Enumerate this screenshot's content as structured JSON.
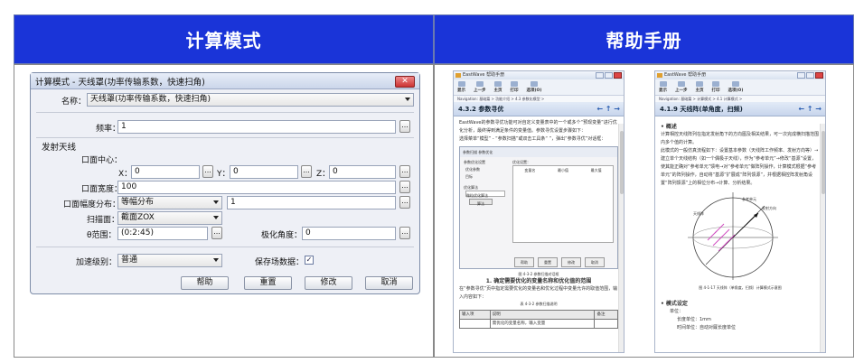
{
  "headers": {
    "left": "计算模式",
    "right": "帮助手册"
  },
  "dialog": {
    "title": "计算模式 - 天线罩(功率传输系数，快速扫角)",
    "close": "✕",
    "name_label": "名称：",
    "name_value": "天线罩(功率传输系数，快速扫角)",
    "freq_label": "频率：",
    "freq_value": "1",
    "group_label": "发射天线",
    "center_label": "口面中心：",
    "x_label": "X：",
    "x_value": "0",
    "y_label": "Y：",
    "y_value": "0",
    "z_label": "Z：",
    "z_value": "0",
    "width_label": "口面宽度：",
    "width_value": "100",
    "dist_label": "口面幅度分布：",
    "dist_value": "等幅分布",
    "dist_extra": "1",
    "scan_label": "扫描面：",
    "scan_value": "截面ZOX",
    "theta_label": "θ范围：",
    "theta_value": "(0:2:45)",
    "pol_label": "极化角度：",
    "pol_value": "0",
    "accel_label": "加速级别：",
    "accel_value": "普通",
    "save_label": "保存场数据：",
    "save_checked": "✓",
    "dots": "...",
    "buttons": {
      "help": "帮助",
      "reset": "重置",
      "modify": "修改",
      "cancel": "取消"
    }
  },
  "help_left": {
    "title": "EastWave 帮助手册",
    "toolbar": [
      "显示",
      "上一步",
      "主页",
      "打印",
      "选项(O)"
    ],
    "nav": "Navigation: 基础篇 > 功能介绍 > 4.3 参数化模型 >",
    "heading": "4.3.2 参数寻优",
    "body1": "EastWave的参数寻优功能可对自定义变量表中的一个或多个“预现变量”进行优化分析，最终得到满足条件的变量值。参数寻优设置步骤如下：",
    "body2": "选择菜单“模型” - “参数扫描”或双击工具条“ ”，弹出“参数寻优”对话框：",
    "dialog_tabs": "参数扫描  参数优化",
    "opt_label": "参数优化设置",
    "radio1": "优化参数",
    "radio2": "目标",
    "list_label": "优化设置：",
    "cols": [
      "变量名",
      "最小值",
      "最大值"
    ],
    "algo_label": "优化算法",
    "algo_value": "微粒优化算法",
    "algo_btn": "算法",
    "sub_buttons": [
      "帮助",
      "重置",
      "修改",
      "取消"
    ],
    "caption": "图 4-3-2 参数扫描对话框",
    "subtitle": "1. 确定需要优化的变量名称和优化值的范围",
    "body3": "在“参数寻优”页中指定需要优化的变量名和优化过程中变量允许的取值范围，输入内容如下：",
    "table_caption": "表 4-3-2 参数扫描说明",
    "table_head": [
      "输入项",
      "说明",
      "备注"
    ],
    "table_row": [
      "",
      "需优化的变量名称，输入变量",
      ""
    ]
  },
  "help_right": {
    "title": "EastWave 帮助手册",
    "toolbar": [
      "显示",
      "上一步",
      "主页",
      "打印",
      "选项(O)"
    ],
    "nav": "Navigation: 基础篇 > 计算模式 > 4.1 计算模式 >",
    "heading": "4.1.9 天线阵(单角度，扫频)",
    "sec1": "• 概述",
    "body1": "计算相控天线阵列在指定发射角下的方向图及相关结果，可一次完成横扫描范围内多个值的计算。",
    "body2": "此模式的一般仿真流程如下：设置基本参数（天线阵工作频率、发射方向等）→建立单个天线结构（如一个偶极子天线），作为“参考单元”→修改“基源”设置，使其能正确对“参考单元”馈电→对“参考单元”做阵列操作，计算模式根据“参考单元”的阵列操作，自动将“基源”扩展成“阵列馈源”，并根据相控阵发射角设置“阵列馈源”上的相位分布→计算、分析结果。",
    "fig_labels": [
      "天线阵",
      "参考单元",
      "发射方向"
    ],
    "caption": "图 4-1-17 天线阵（单角度，扫频）计算模式示意图",
    "sec2": "• 模式设定",
    "unit_label": "单位：",
    "unit_len": "长度单位：1mm",
    "unit_time": "时间单位：自动对厩长度单位"
  }
}
